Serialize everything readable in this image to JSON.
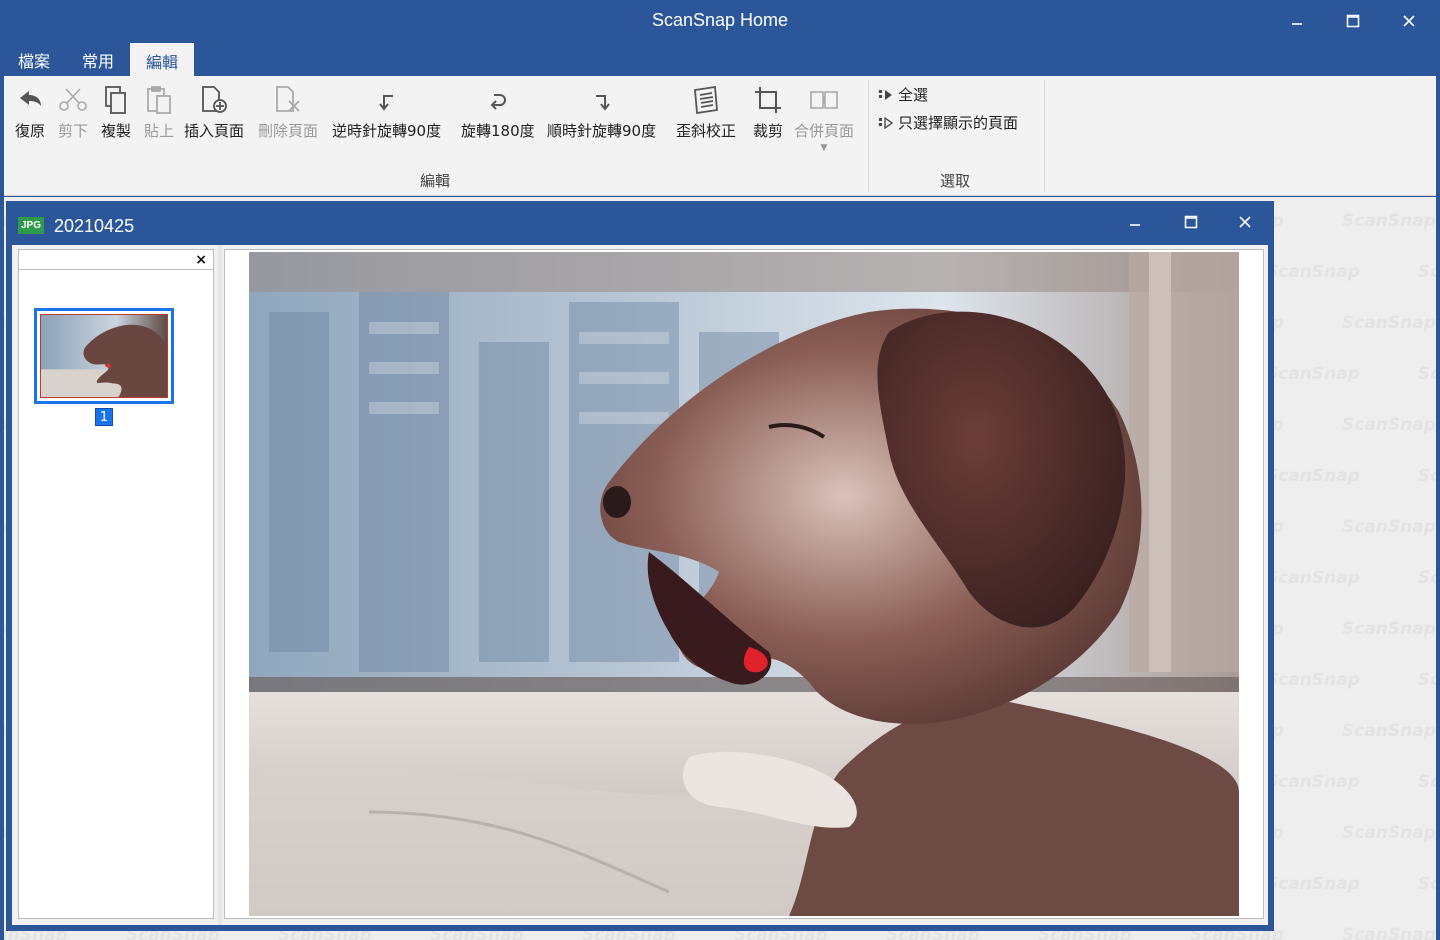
{
  "app": {
    "title": "ScanSnap Home",
    "controls": [
      "minimize-icon",
      "maximize-icon",
      "close-icon"
    ]
  },
  "tabs": [
    {
      "label": "檔案",
      "active": false
    },
    {
      "label": "常用",
      "active": false
    },
    {
      "label": "編輯",
      "active": true
    }
  ],
  "ribbon": {
    "edit_group": {
      "label": "編輯",
      "buttons": [
        {
          "label": "復原",
          "icon": "undo-icon",
          "enabled": true
        },
        {
          "label": "剪下",
          "icon": "scissors-icon",
          "enabled": false
        },
        {
          "label": "複製",
          "icon": "copy-icon",
          "enabled": true
        },
        {
          "label": "貼上",
          "icon": "paste-icon",
          "enabled": false
        },
        {
          "label": "插入頁面",
          "icon": "insert-page-icon",
          "enabled": true
        },
        {
          "label": "刪除頁面",
          "icon": "delete-page-icon",
          "enabled": false
        },
        {
          "label": "逆時針旋轉90度",
          "icon": "rotate-ccw-icon",
          "enabled": true
        },
        {
          "label": "旋轉180度",
          "icon": "rotate-180-icon",
          "enabled": true
        },
        {
          "label": "順時針旋轉90度",
          "icon": "rotate-cw-icon",
          "enabled": true
        },
        {
          "label": "歪斜校正",
          "icon": "deskew-icon",
          "enabled": true
        },
        {
          "label": "裁剪",
          "icon": "crop-icon",
          "enabled": true
        },
        {
          "label": "合併頁面",
          "icon": "merge-pages-icon",
          "enabled": false
        }
      ]
    },
    "select_group": {
      "label": "選取",
      "items": [
        {
          "label": "全選",
          "icon": "select-all-icon"
        },
        {
          "label": "只選擇顯示的頁面",
          "icon": "select-displayed-icon"
        }
      ]
    }
  },
  "viewer": {
    "file_badge": "JPG",
    "file_name": "20210425",
    "page_number": "1",
    "thumb_close": "×"
  },
  "watermark": "ScanSnap",
  "colors": {
    "brand": "#2b579a",
    "selection": "#1a73e8",
    "ribbon_bg": "#f3f3f3",
    "badge": "#2e9a4a"
  }
}
